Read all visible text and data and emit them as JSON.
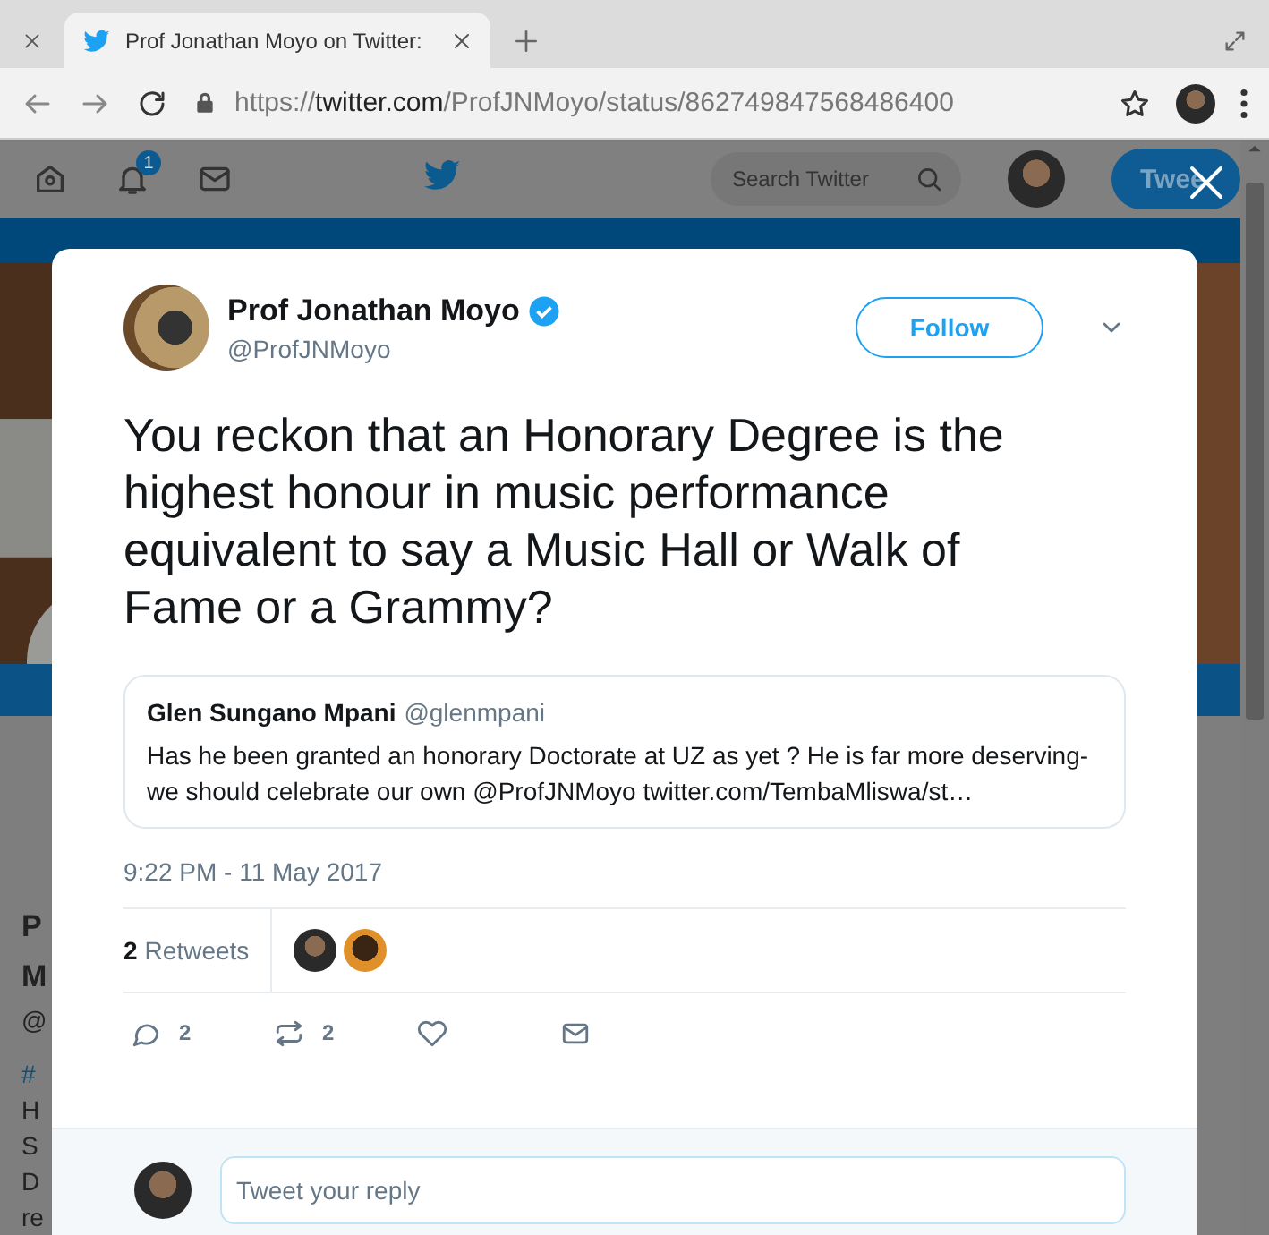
{
  "browser": {
    "tabs": [
      {
        "title": "Prof Jonathan Moyo on Twitter:",
        "selected": true
      }
    ],
    "url": {
      "scheme": "https://",
      "host": "twitter.com",
      "path": "/ProfJNMoyo/status/862749847568486400"
    }
  },
  "nav": {
    "notifications_badge": "1",
    "search": {
      "placeholder": "Search Twitter"
    },
    "tweet_button": "Twee"
  },
  "background_fragments": [
    {
      "text": "P",
      "kind": "heading"
    },
    {
      "text": "M",
      "kind": "heading"
    },
    {
      "text": "@",
      "kind": "handle"
    },
    {
      "text": "#",
      "kind": "link"
    },
    {
      "text": "H",
      "kind": "body"
    },
    {
      "text": "S",
      "kind": "body"
    },
    {
      "text": "D",
      "kind": "body"
    },
    {
      "text": "re",
      "kind": "body"
    }
  ],
  "tweet": {
    "author": {
      "name": "Prof Jonathan Moyo",
      "handle": "@ProfJNMoyo",
      "verified": true
    },
    "follow_button": "Follow",
    "text": "You reckon that an Honorary Degree is the highest honour in music performance equivalent to say a Music Hall or Walk of Fame or a Grammy?",
    "quoted": {
      "name": "Glen Sungano Mpani",
      "handle": "@glenmpani",
      "text": "Has he been granted an honorary Doctorate  at UZ as yet ? He is far more deserving- we should celebrate our own @ProfJNMoyo twitter.com/TembaMliswa/st…"
    },
    "time": "9:22 PM - 11 May 2017",
    "retweets": {
      "count": "2",
      "label": "Retweets"
    },
    "actions": [
      {
        "kind": "reply",
        "count": "2"
      },
      {
        "kind": "retweet",
        "count": "2"
      },
      {
        "kind": "like"
      },
      {
        "kind": "message"
      }
    ],
    "reply": {
      "placeholder": "Tweet your reply"
    }
  }
}
